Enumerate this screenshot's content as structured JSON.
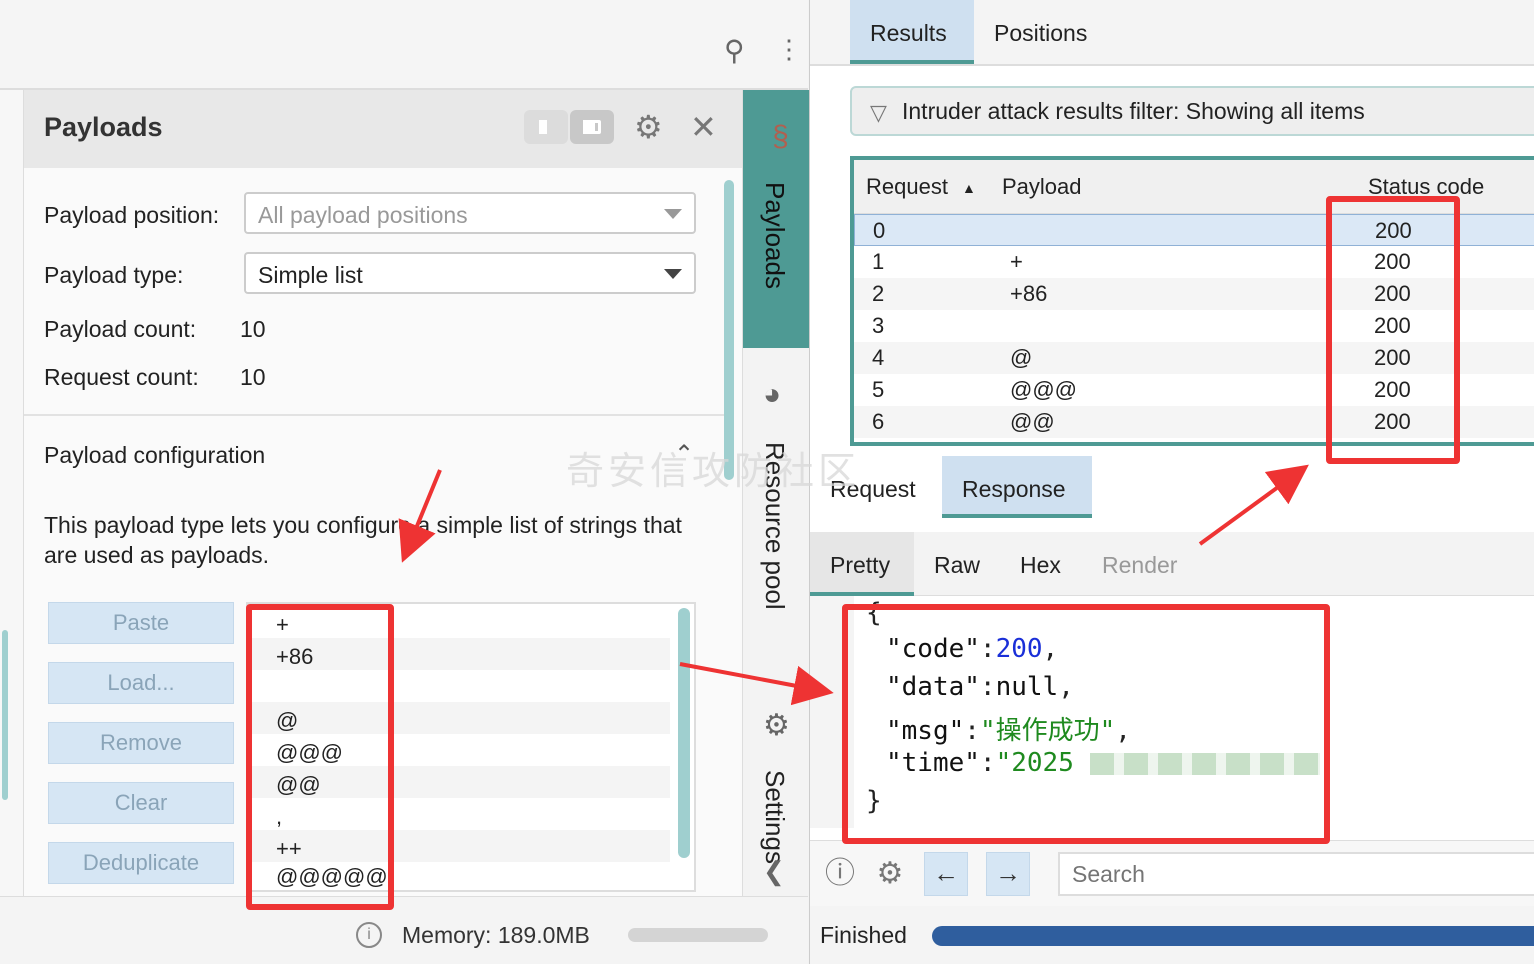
{
  "left": {
    "panel_title": "Payloads",
    "payload_position_label": "Payload position:",
    "payload_position_placeholder": "All payload positions",
    "payload_type_label": "Payload type:",
    "payload_type_value": "Simple list",
    "payload_count_label": "Payload count:",
    "payload_count_value": "10",
    "request_count_label": "Request count:",
    "request_count_value": "10",
    "config_title": "Payload configuration",
    "config_desc": "This payload type lets you configure a simple list of strings that are used as payloads.",
    "buttons": [
      "Paste",
      "Load...",
      "Remove",
      "Clear",
      "Deduplicate"
    ],
    "list_items": [
      "+",
      "+86",
      "",
      "@",
      "@@@",
      "@@",
      ",",
      "++",
      "@@@@@"
    ],
    "vertical_tabs": {
      "payloads": "Payloads",
      "resource_pool": "Resource pool",
      "settings": "Settings"
    },
    "memory": "Memory: 189.0MB"
  },
  "right": {
    "tabs": [
      "Results",
      "Positions"
    ],
    "filter_text": "Intruder attack results filter: Showing all items",
    "table": {
      "headers": [
        "Request",
        "Payload",
        "Status code"
      ],
      "rows": [
        {
          "request": "0",
          "payload": "",
          "status": "200"
        },
        {
          "request": "1",
          "payload": "+",
          "status": "200"
        },
        {
          "request": "2",
          "payload": "+86",
          "status": "200"
        },
        {
          "request": "3",
          "payload": "",
          "status": "200"
        },
        {
          "request": "4",
          "payload": "@",
          "status": "200"
        },
        {
          "request": "5",
          "payload": "@@@",
          "status": "200"
        },
        {
          "request": "6",
          "payload": "@@",
          "status": "200"
        }
      ]
    },
    "req_res_tabs": [
      "Request",
      "Response"
    ],
    "view_tabs": [
      "Pretty",
      "Raw",
      "Hex",
      "Render"
    ],
    "code": {
      "open": "{",
      "code_key": "\"code\"",
      "code_val": "200",
      "data_key": "\"data\"",
      "data_val": "null",
      "msg_key": "\"msg\"",
      "msg_val": "\"操作成功\"",
      "time_key": "\"time\"",
      "time_val": "\"2025",
      "close": "}"
    },
    "search_placeholder": "Search",
    "status": "Finished",
    "progress": 1.0
  },
  "watermark": "奇安信攻防社区"
}
